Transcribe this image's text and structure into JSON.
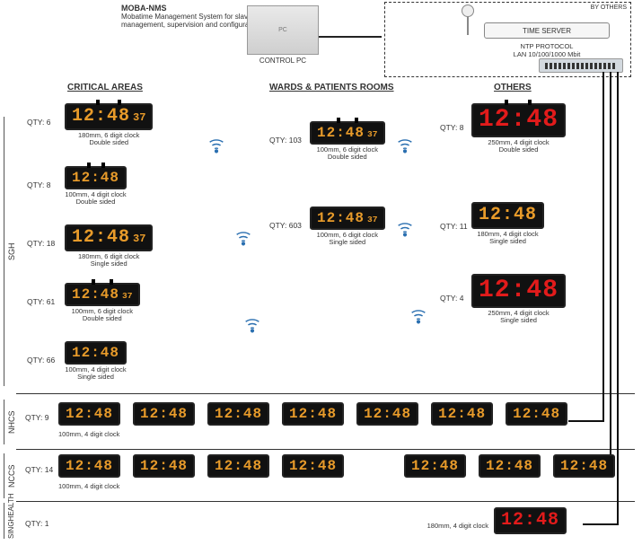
{
  "moba": {
    "title": "MOBA-NMS",
    "desc": "Mobatime Management System for slave clock management, supervision and configuration"
  },
  "control_pc": {
    "label": "CONTROL PC",
    "placeholder": "PC"
  },
  "timeserver": {
    "by_others": "BY OTHERS",
    "label": "TIME SERVER",
    "proto": "NTP PROTOCOL",
    "lan": "LAN 10/100/1000 Mbit"
  },
  "headers": {
    "critical": "CRITICAL AREAS",
    "wards": "WARDS & PATIENTS ROOMS",
    "others": "OTHERS"
  },
  "sections": {
    "sgh": "SGH",
    "nhcs": "NHCS",
    "nccs": "NCCS",
    "singhealth": "SINGHEALTH"
  },
  "time": {
    "main": "12:48",
    "sec": "37"
  },
  "captions": {
    "c180_6_ds": "180mm, 6 digit clock\nDouble sided",
    "c100_4_ds": "100mm, 4 digit clock\nDouble sided",
    "c180_6_ss": "180mm, 6 digit clock\nSingle sided",
    "c100_6_ds": "100mm, 6 digit clock\nDouble sided",
    "c100_6_ss": "100mm, 6 digit clock\nSingle sided",
    "c100_4_ss": "100mm, 4 digit clock\nSingle sided",
    "c250_4_ds": "250mm, 4 digit clock\nDouble sided",
    "c180_4_ss": "180mm, 4 digit clock\nSingle sided",
    "c250_4_ss": "250mm, 4 digit clock\nSingle sided",
    "c100_4": "100mm, 4 digit clock",
    "c180_4": "180mm, 4 digit clock"
  },
  "critical": [
    {
      "qty": "QTY: 6",
      "caption_key": "c180_6_ds",
      "size": "sz-m",
      "six": true,
      "mounts": true
    },
    {
      "qty": "QTY: 8",
      "caption_key": "c100_4_ds",
      "size": "sz-s",
      "six": false,
      "mounts": true
    },
    {
      "qty": "QTY: 18",
      "caption_key": "c180_6_ss",
      "size": "sz-m",
      "six": true,
      "mounts": false
    },
    {
      "qty": "QTY: 61",
      "caption_key": "c100_6_ds",
      "size": "sz-s",
      "six": true,
      "mounts": true
    },
    {
      "qty": "QTY: 66",
      "caption_key": "c100_4_ss",
      "size": "sz-s",
      "six": false,
      "mounts": false
    }
  ],
  "wards": [
    {
      "qty": "QTY: 103",
      "caption_key": "c100_6_ds",
      "size": "sz-s",
      "six": true,
      "mounts": true
    },
    {
      "qty": "QTY: 603",
      "caption_key": "c100_6_ss",
      "size": "sz-s",
      "six": true,
      "mounts": false
    }
  ],
  "others": [
    {
      "qty": "QTY: 8",
      "caption_key": "c250_4_ds",
      "size": "sz-l",
      "six": false,
      "mounts": true,
      "color": "red"
    },
    {
      "qty": "QTY: 11",
      "caption_key": "c180_4_ss",
      "size": "sz-m",
      "six": false,
      "mounts": false,
      "color": "amber"
    },
    {
      "qty": "QTY: 4",
      "caption_key": "c250_4_ss",
      "size": "sz-l",
      "six": false,
      "mounts": false,
      "color": "red"
    }
  ],
  "nhcs": {
    "qty": "QTY: 9",
    "caption_key": "c100_4",
    "count": 7,
    "color": "amber"
  },
  "nccs": {
    "qty": "QTY: 14",
    "caption_key": "c100_4",
    "count_left": 4,
    "count_right": 3,
    "color": "amber"
  },
  "singhealth": {
    "qty": "QTY: 1",
    "caption_key": "c180_4",
    "color": "red"
  }
}
